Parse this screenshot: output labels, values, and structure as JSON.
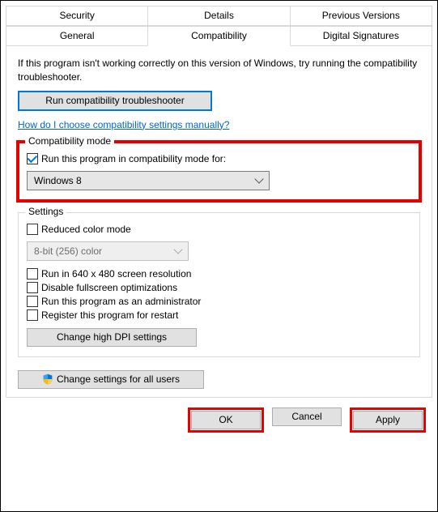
{
  "tabs": {
    "row1": [
      "Security",
      "Details",
      "Previous Versions"
    ],
    "row2": [
      "General",
      "Compatibility",
      "Digital Signatures"
    ],
    "active": "Compatibility"
  },
  "intro": "If this program isn't working correctly on this version of Windows, try running the compatibility troubleshooter.",
  "troubleshooter_btn": "Run compatibility troubleshooter",
  "manual_link": "How do I choose compatibility settings manually?",
  "compat_mode": {
    "title": "Compatibility mode",
    "checkbox_label": "Run this program in compatibility mode for:",
    "checked": true,
    "selected": "Windows 8"
  },
  "settings": {
    "title": "Settings",
    "reduced_color": {
      "label": "Reduced color mode",
      "checked": false
    },
    "color_select": "8-bit (256) color",
    "res640": {
      "label": "Run in 640 x 480 screen resolution",
      "checked": false
    },
    "disable_fullscreen": {
      "label": "Disable fullscreen optimizations",
      "checked": false
    },
    "run_admin": {
      "label": "Run this program as an administrator",
      "checked": false
    },
    "register_restart": {
      "label": "Register this program for restart",
      "checked": false
    },
    "dpi_btn": "Change high DPI settings"
  },
  "all_users_btn": "Change settings for all users",
  "footer": {
    "ok": "OK",
    "cancel": "Cancel",
    "apply": "Apply"
  }
}
